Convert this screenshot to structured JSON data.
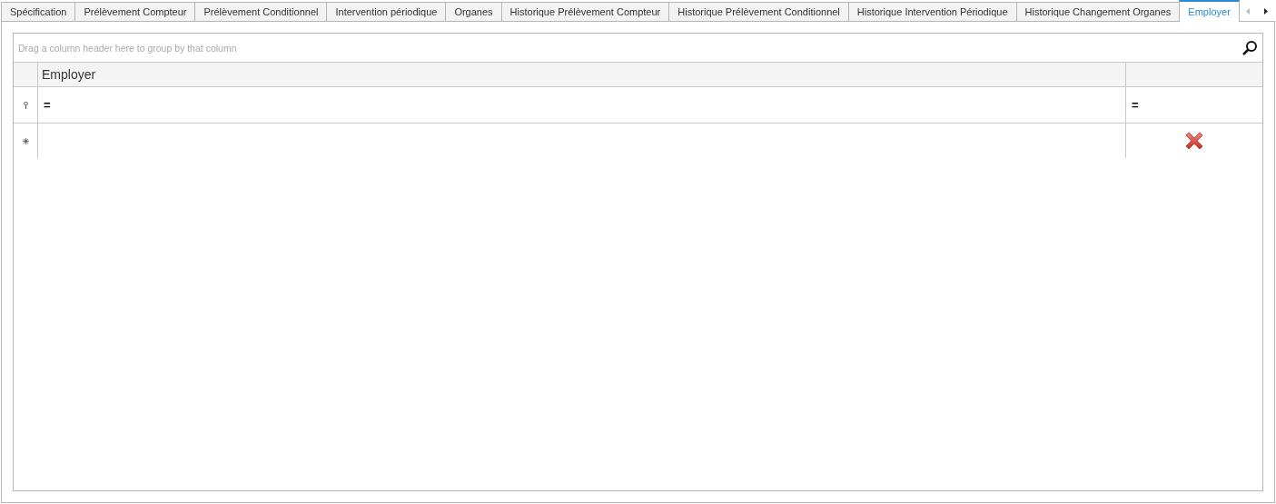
{
  "tabs": [
    {
      "label": "Spécification",
      "selected": false
    },
    {
      "label": "Prélèvement Compteur",
      "selected": false
    },
    {
      "label": "Prélèvement Conditionnel",
      "selected": false
    },
    {
      "label": "Intervention périodique",
      "selected": false
    },
    {
      "label": "Organes",
      "selected": false
    },
    {
      "label": "Historique Prélèvement Compteur",
      "selected": false
    },
    {
      "label": "Historique Prélèvement Conditionnel",
      "selected": false
    },
    {
      "label": "Historique Intervention Périodique",
      "selected": false
    },
    {
      "label": "Historique Changement Organes",
      "selected": false
    },
    {
      "label": "Employer",
      "selected": true
    }
  ],
  "grid": {
    "group_panel": {
      "placeholder": "Drag a column header here to group by that column"
    },
    "columns": [
      {
        "header": "Employer"
      },
      {}
    ],
    "filter_row": {
      "conditions": [
        "=",
        "="
      ]
    }
  }
}
